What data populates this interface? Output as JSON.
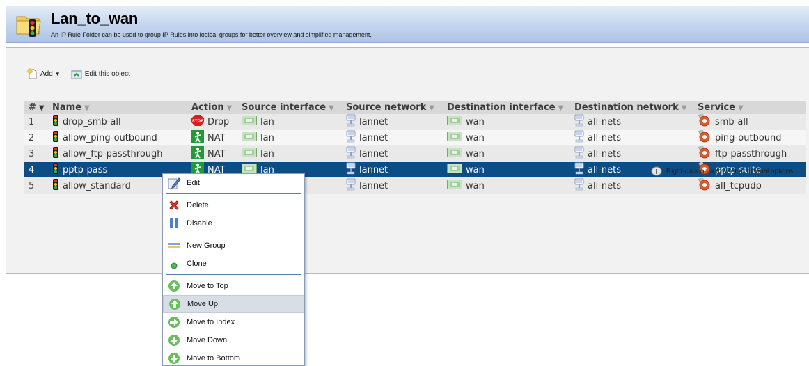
{
  "header": {
    "title": "Lan_to_wan",
    "subtitle": "An IP Rule Folder can be used to group IP Rules into logical groups for better overview and simplified management."
  },
  "toolbar": {
    "add_label": "Add",
    "edit_label": "Edit this object"
  },
  "table": {
    "columns": [
      "#",
      "Name",
      "Action",
      "Source interface",
      "Source network",
      "Destination interface",
      "Destination network",
      "Service"
    ],
    "rows": [
      {
        "num": "1",
        "name": "drop_smb-all",
        "action": "Drop",
        "src_if": "lan",
        "src_net": "lannet",
        "dst_if": "wan",
        "dst_net": "all-nets",
        "service": "smb-all"
      },
      {
        "num": "2",
        "name": "allow_ping-outbound",
        "action": "NAT",
        "src_if": "lan",
        "src_net": "lannet",
        "dst_if": "wan",
        "dst_net": "all-nets",
        "service": "ping-outbound"
      },
      {
        "num": "3",
        "name": "allow_ftp-passthrough",
        "action": "NAT",
        "src_if": "lan",
        "src_net": "lannet",
        "dst_if": "wan",
        "dst_net": "all-nets",
        "service": "ftp-passthrough"
      },
      {
        "num": "4",
        "name": "pptp-pass",
        "action": "NAT",
        "src_if": "lan",
        "src_net": "lannet",
        "dst_if": "wan",
        "dst_net": "all-nets",
        "service": "pptp-suite"
      },
      {
        "num": "5",
        "name": "allow_standard",
        "action": "",
        "src_if": "",
        "src_net": "lannet",
        "dst_if": "wan",
        "dst_net": "all-nets",
        "service": "all_tcpudp"
      }
    ]
  },
  "hint": "Right-click on a row for additional options.",
  "context_menu": {
    "items": [
      "Edit",
      "Delete",
      "Disable",
      "New Group",
      "Clone",
      "Move to Top",
      "Move Up",
      "Move to Index",
      "Move Down",
      "Move to Bottom"
    ]
  },
  "colors": {
    "selected_row": "#0d4d86",
    "header_gradient_mid": "#c3d4ec",
    "drop_icon": "#d81e1e",
    "nat_icon": "#1f9b3a",
    "service_icon": "#e05a2a"
  }
}
